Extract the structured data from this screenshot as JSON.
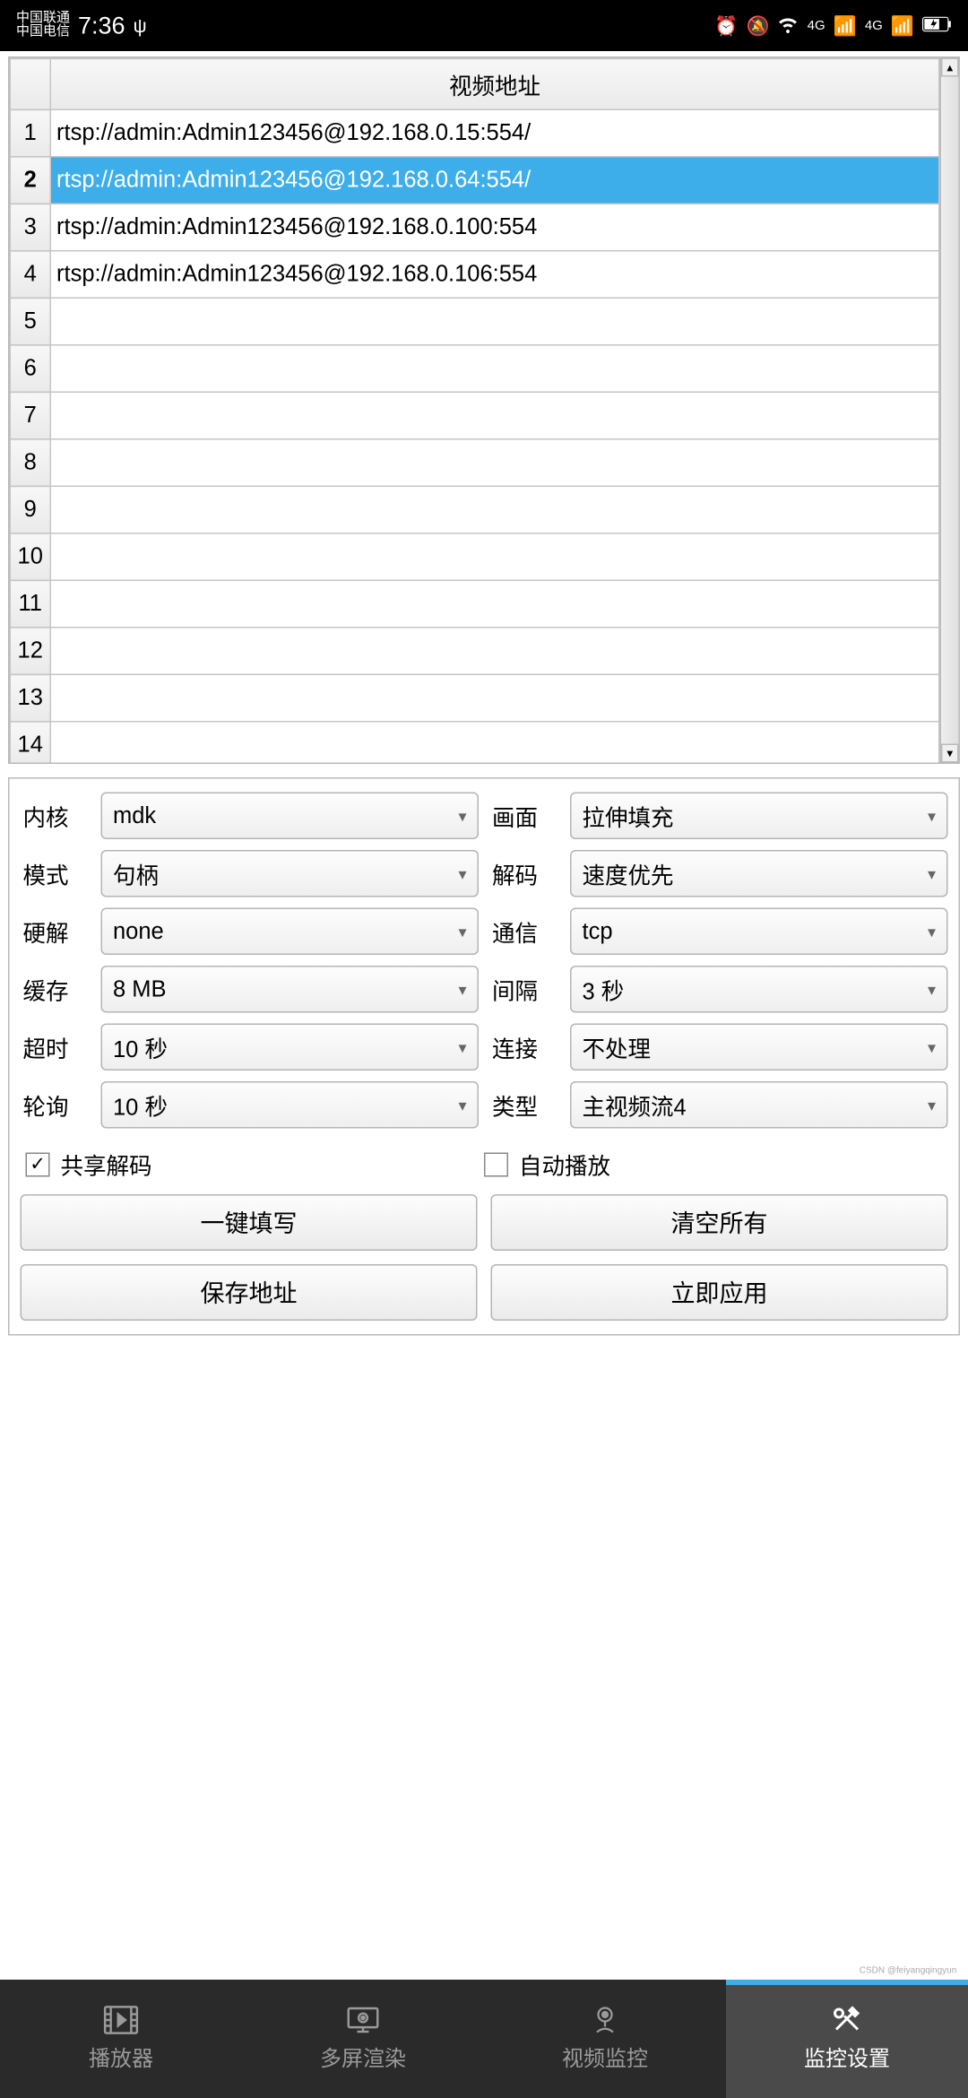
{
  "status": {
    "carrier1": "中国联通",
    "carrier2": "中国电信",
    "time": "7:36",
    "net_label": "4G"
  },
  "table": {
    "header": "视频地址",
    "selected_index": 2,
    "rows": [
      {
        "n": "1",
        "v": "rtsp://admin:Admin123456@192.168.0.15:554/"
      },
      {
        "n": "2",
        "v": "rtsp://admin:Admin123456@192.168.0.64:554/"
      },
      {
        "n": "3",
        "v": "rtsp://admin:Admin123456@192.168.0.100:554"
      },
      {
        "n": "4",
        "v": "rtsp://admin:Admin123456@192.168.0.106:554"
      },
      {
        "n": "5",
        "v": ""
      },
      {
        "n": "6",
        "v": ""
      },
      {
        "n": "7",
        "v": ""
      },
      {
        "n": "8",
        "v": ""
      },
      {
        "n": "9",
        "v": ""
      },
      {
        "n": "10",
        "v": ""
      },
      {
        "n": "11",
        "v": ""
      },
      {
        "n": "12",
        "v": ""
      },
      {
        "n": "13",
        "v": ""
      },
      {
        "n": "14",
        "v": ""
      }
    ]
  },
  "form": {
    "kernel_label": "内核",
    "kernel_value": "mdk",
    "frame_label": "画面",
    "frame_value": "拉伸填充",
    "mode_label": "模式",
    "mode_value": "句柄",
    "decode_label": "解码",
    "decode_value": "速度优先",
    "hw_label": "硬解",
    "hw_value": "none",
    "comm_label": "通信",
    "comm_value": "tcp",
    "cache_label": "缓存",
    "cache_value": "8 MB",
    "interval_label": "间隔",
    "interval_value": "3 秒",
    "timeout_label": "超时",
    "timeout_value": "10 秒",
    "connect_label": "连接",
    "connect_value": "不处理",
    "poll_label": "轮询",
    "poll_value": "10 秒",
    "type_label": "类型",
    "type_value": "主视频流4"
  },
  "checks": {
    "share_decode": {
      "label": "共享解码",
      "checked": true
    },
    "autoplay": {
      "label": "自动播放",
      "checked": false
    }
  },
  "buttons": {
    "fill_all": "一键填写",
    "clear_all": "清空所有",
    "save_addr": "保存地址",
    "apply_now": "立即应用"
  },
  "nav": {
    "player": "播放器",
    "multi": "多屏渲染",
    "monitor": "视频监控",
    "settings": "监控设置"
  },
  "watermark": "CSDN @feiyangqingyun"
}
